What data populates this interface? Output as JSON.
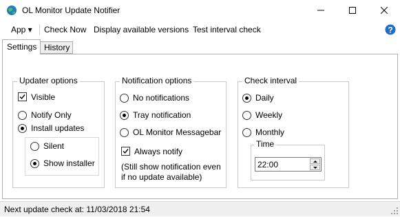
{
  "window": {
    "title": "OL Monitor Update Notifier"
  },
  "menu": {
    "app": "App ▾",
    "check_now": "Check Now",
    "display_versions": "Display available versions",
    "test_interval": "Test interval check"
  },
  "tabs": [
    {
      "label": "Settings",
      "active": true
    },
    {
      "label": "History",
      "active": false
    }
  ],
  "updater_options": {
    "title": "Updater options",
    "visible": {
      "label": "Visible",
      "checked": true
    },
    "notify_only": {
      "label": "Notify Only",
      "selected": false
    },
    "install_updates": {
      "label": "Install updates",
      "selected": true
    },
    "silent": {
      "label": "Silent",
      "selected": false
    },
    "show_installer": {
      "label": "Show installer",
      "selected": true
    }
  },
  "notification_options": {
    "title": "Notification options",
    "no_notifications": {
      "label": "No notifications",
      "selected": false
    },
    "tray_notification": {
      "label": "Tray notification",
      "selected": true
    },
    "messagebar": {
      "label": "OL Monitor Messagebar",
      "selected": false
    },
    "always_notify": {
      "label": "Always notify",
      "checked": true
    },
    "hint_line1": "(Still show notification even",
    "hint_line2": "if no update available)"
  },
  "check_interval": {
    "title": "Check interval",
    "daily": {
      "label": "Daily",
      "selected": true
    },
    "weekly": {
      "label": "Weekly",
      "selected": false
    },
    "monthly": {
      "label": "Monthly",
      "selected": false
    },
    "time_group_title": "Time",
    "time_value": "22:00"
  },
  "status": {
    "text": "Next update check at: 11/03/2018 21:54"
  },
  "colors": {
    "help_icon": "#1e6ec8",
    "status_bg": "#f0f0f0",
    "border": "#adadad"
  }
}
